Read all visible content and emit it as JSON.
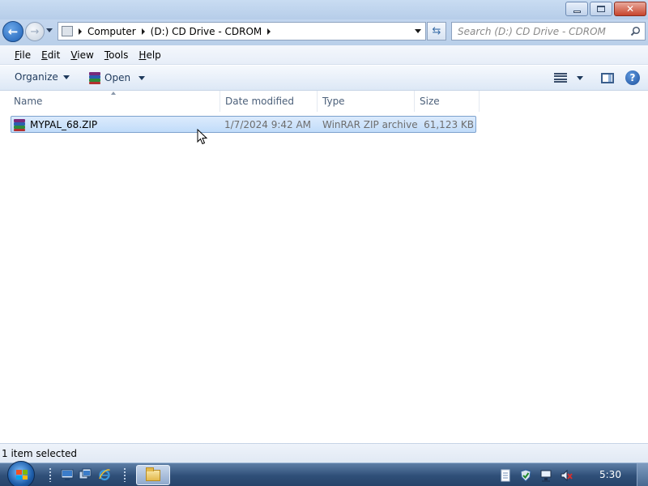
{
  "window": {
    "minimize_icon": "minimize-icon",
    "maximize_icon": "restore-icon",
    "close_icon": "close-icon"
  },
  "nav": {
    "back_icon": "back-arrow-icon",
    "forward_icon": "forward-arrow-icon",
    "breadcrumb": [
      "Computer",
      "(D:) CD Drive - CDROM"
    ],
    "search_placeholder": "Search (D:) CD Drive - CDROM"
  },
  "menu": [
    {
      "underline": "F",
      "rest": "ile"
    },
    {
      "underline": "E",
      "rest": "dit"
    },
    {
      "underline": "V",
      "rest": "iew"
    },
    {
      "underline": "T",
      "rest": "ools"
    },
    {
      "underline": "H",
      "rest": "elp"
    }
  ],
  "toolbar": {
    "organize_label": "Organize",
    "open_label": "Open",
    "help_label": "?"
  },
  "columns": [
    "Name",
    "Date modified",
    "Type",
    "Size"
  ],
  "files": [
    {
      "name": "MYPAL_68.ZIP",
      "date_modified": "1/7/2024 9:42 AM",
      "type": "WinRAR ZIP archive",
      "size": "61,123 KB",
      "icon": "winrar-archive-icon",
      "selected": true
    }
  ],
  "status": {
    "text": "1 item selected"
  },
  "taskbar": {
    "clock": "5:30"
  },
  "colors": {
    "selection_fill": "#c8e0fb",
    "selection_border": "#7da2ce",
    "header_text": "#4c607a",
    "taskbar": "#2f4f78"
  }
}
